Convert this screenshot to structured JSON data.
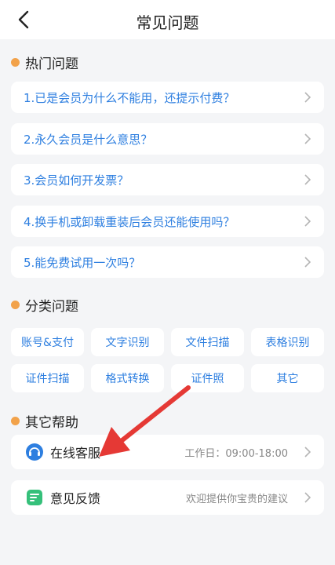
{
  "header": {
    "title": "常见问题"
  },
  "hot": {
    "title": "热门问题",
    "items": [
      "1.已是会员为什么不能用，还提示付费？",
      "2.永久会员是什么意思？",
      "3.会员如何开发票？",
      "4.换手机或卸载重装后会员还能使用吗？",
      "5.能免费试用一次吗？"
    ]
  },
  "categories": {
    "title": "分类问题",
    "items": [
      "账号&支付",
      "文字识别",
      "文件扫描",
      "表格识别",
      "证件扫描",
      "格式转换",
      "证件照",
      "其它"
    ]
  },
  "help": {
    "title": "其它帮助",
    "service": {
      "label": "在线客服",
      "meta": "工作日：09:00-18:00"
    },
    "feedback": {
      "label": "意见反馈",
      "meta": "欢迎提供你宝贵的建议"
    }
  },
  "colors": {
    "accent": "#2e7fe0",
    "dot": "#f2a24a",
    "arrow": "#e53935"
  },
  "icons": {
    "service": "headset-icon",
    "feedback": "feedback-icon"
  }
}
